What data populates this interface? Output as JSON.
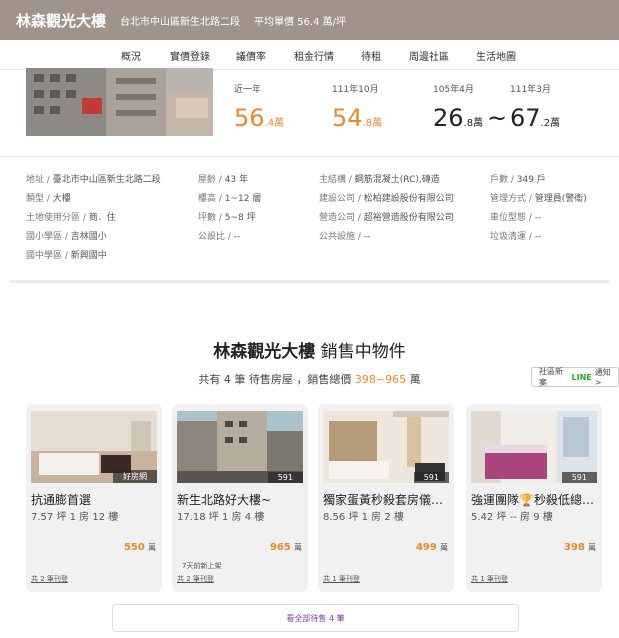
{
  "header": {
    "building_name": "林森觀光大樓",
    "address": "台北市中山區新生北路二段",
    "avg_price": "平均單價 56.4 萬/坪",
    "bg_color": "#a0938a"
  },
  "tabs": [
    "概況",
    "實價登錄",
    "議價率",
    "租金行情",
    "待租",
    "周邊社區",
    "生活地圖"
  ],
  "prices": [
    {
      "label": "近一年",
      "int": "56",
      "dec": ".4",
      "unit": "萬"
    },
    {
      "label": "111年10月",
      "int": "54",
      "dec": ".8",
      "unit": "萬"
    },
    {
      "label": "105年4月",
      "int": "26",
      "dec": ".8",
      "unit": "萬"
    },
    {
      "label": "111年3月",
      "int": "67",
      "dec": ".2",
      "unit": "萬"
    }
  ],
  "tilde": "~",
  "info": {
    "col1": [
      {
        "k": "地址 / ",
        "v": "臺北市中山區新生北路二段"
      },
      {
        "k": "類型 / ",
        "v": "大樓"
      },
      {
        "k": "土地使用分區 / ",
        "v": "商．住"
      },
      {
        "k": "國小學區 / ",
        "v": "吉林國小"
      },
      {
        "k": "國中學區 / ",
        "v": "新興國中"
      }
    ],
    "col2": [
      {
        "k": "屋齡 / ",
        "v": "43 年"
      },
      {
        "k": "樓高 / ",
        "v": "1~12 層"
      },
      {
        "k": "坪數 / ",
        "v": "5~8 坪"
      },
      {
        "k": "公設比 / ",
        "v": "--"
      }
    ],
    "col3": [
      {
        "k": "主結構 / ",
        "v": "鋼筋混凝土(RC),磚造"
      },
      {
        "k": "建設公司 / ",
        "v": "松柏建設股份有限公司"
      },
      {
        "k": "營造公司 / ",
        "v": "超裕營造股份有限公司"
      },
      {
        "k": "公共設施 / ",
        "v": "--"
      }
    ],
    "col4": [
      {
        "k": "戶數 / ",
        "v": "349 戶"
      },
      {
        "k": "管理方式 / ",
        "v": "管理員(警衛)"
      },
      {
        "k": "車位型態 / ",
        "v": "--"
      },
      {
        "k": "垃圾清運 / ",
        "v": "--"
      }
    ]
  },
  "section": {
    "title_name": "林森觀光大樓",
    "title_suffix": " 銷售中物件",
    "summary_pre": "共有 4 筆 待售房屋 ，銷售總價 ",
    "summary_range": "398~965",
    "summary_unit": " 萬",
    "line_pre": "社區新案",
    "line_brand": "LINE",
    "line_post": "通知 >"
  },
  "listings": [
    {
      "badge": "好房網",
      "title": "抗通膨首選",
      "spec": "7.57 坪 1 房 12 樓",
      "price": "550",
      "unit": "萬",
      "note": "",
      "agent": "共 2 筆刊登"
    },
    {
      "badge": "591",
      "title": "新生北路好大樓~",
      "spec": "17.18 坪 1 房 4 樓",
      "price": "965",
      "unit": "萬",
      "note": "7天前新上架",
      "agent": "共 2 筆刊登"
    },
    {
      "badge": "591",
      "title": "獨家蛋黃秒殺套房儀…",
      "spec": "8.56 坪 1 房 2 樓",
      "price": "499",
      "unit": "萬",
      "note": "",
      "agent": "共 1 筆刊登"
    },
    {
      "badge": "591",
      "title": "強運團隊🏆秒殺低總…",
      "spec": "5.42 坪 -- 房 9 樓",
      "price": "398",
      "unit": "萬",
      "note": "",
      "agent": "共 1 筆刊登"
    }
  ],
  "view_all": "看全部待售 4 筆",
  "colors": {
    "accent_orange": "#e8892a",
    "tab_underline": "#8fb838",
    "link_purple": "#7a3ea0"
  }
}
